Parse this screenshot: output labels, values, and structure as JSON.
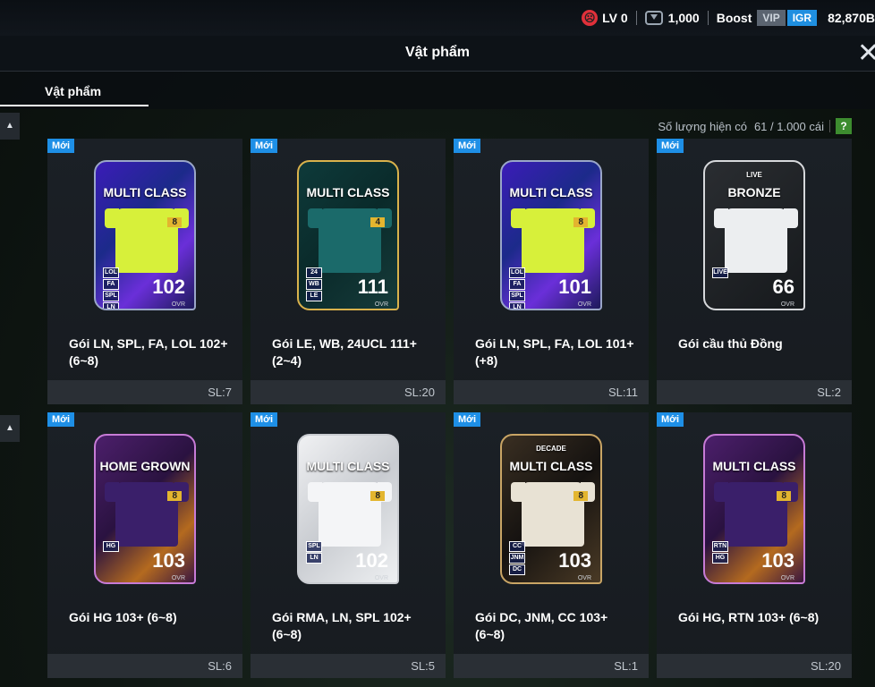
{
  "topbar": {
    "level": "LV 0",
    "coins": "1,000",
    "boost": "Boost",
    "vip": "VIP",
    "igr": "IGR",
    "balance": "82,870B"
  },
  "window": {
    "title": "Vật phẩm",
    "close": "✕"
  },
  "tabs": [
    {
      "label": "Vật phẩm"
    }
  ],
  "inventory": {
    "label": "Số lượng hiện có",
    "value": "61 / 1.000 cái",
    "help": "?"
  },
  "new_badge": "Mới",
  "items": [
    {
      "name": "Gói LN, SPL, FA, LOL 102+ (6~8)",
      "qty": "SL:7",
      "card_title": "MULTI CLASS",
      "level": "8",
      "ovr": "102",
      "ovr_label": "OVR",
      "positions": [
        "LOL",
        "FA",
        "SPL",
        "LN"
      ],
      "style": "p1"
    },
    {
      "name": "Gói LE, WB, 24UCL 111+ (2~4)",
      "qty": "SL:20",
      "card_title": "MULTI CLASS",
      "level": "4",
      "ovr": "111",
      "ovr_label": "OVR",
      "positions": [
        "24",
        "WB",
        "LE"
      ],
      "style": "p2"
    },
    {
      "name": "Gói LN, SPL, FA, LOL 101+ (+8)",
      "qty": "SL:11",
      "card_title": "MULTI CLASS",
      "level": "8",
      "ovr": "101",
      "ovr_label": "OVR",
      "positions": [
        "LOL",
        "FA",
        "SPL",
        "LN"
      ],
      "style": "p1"
    },
    {
      "name": "Gói cầu thủ Đồng",
      "qty": "SL:2",
      "card_title": "BRONZE",
      "card_sub": "LIVE",
      "level": "",
      "ovr": "66",
      "ovr_label": "OVR",
      "positions": [
        "LIVE"
      ],
      "style": "p3"
    },
    {
      "name": "Gói HG 103+ (6~8)",
      "qty": "SL:6",
      "card_title": "HOME GROWN",
      "level": "8",
      "ovr": "103",
      "ovr_label": "OVR",
      "positions": [
        "HG"
      ],
      "style": "p4"
    },
    {
      "name": "Gói RMA, LN, SPL 102+ (6~8)",
      "qty": "SL:5",
      "card_title": "MULTI CLASS",
      "level": "8",
      "ovr": "102",
      "ovr_label": "OVR",
      "positions": [
        "SPL",
        "LN"
      ],
      "style": "p5"
    },
    {
      "name": "Gói DC, JNM, CC 103+ (6~8)",
      "qty": "SL:1",
      "card_title": "MULTI CLASS",
      "card_sub": "DECADE",
      "level": "8",
      "ovr": "103",
      "ovr_label": "OVR",
      "positions": [
        "CC",
        "JNM",
        "DC"
      ],
      "style": "p6"
    },
    {
      "name": "Gói HG, RTN 103+ (6~8)",
      "qty": "SL:20",
      "card_title": "MULTI CLASS",
      "level": "8",
      "ovr": "103",
      "ovr_label": "OVR",
      "positions": [
        "RTN",
        "HG"
      ],
      "style": "p4"
    }
  ],
  "colors": {
    "accent": "#1e8fe6",
    "ovr_up": "#4fd34f",
    "help": "#3d8c2f"
  }
}
